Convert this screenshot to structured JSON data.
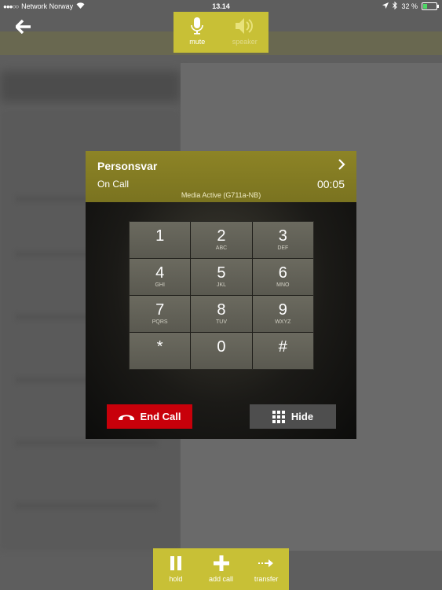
{
  "status_bar": {
    "signal": "●●●○○",
    "carrier": "Network Norway",
    "time": "13.14",
    "battery": "32 %"
  },
  "top_controls": {
    "mute_label": "mute",
    "speaker_label": "speaker"
  },
  "call": {
    "caller_name": "Personsvar",
    "status": "On Call",
    "timer": "00:05",
    "media_status": "Media Active (G711a-NB)"
  },
  "keypad": [
    {
      "digit": "1",
      "letters": ""
    },
    {
      "digit": "2",
      "letters": "ABC"
    },
    {
      "digit": "3",
      "letters": "DEF"
    },
    {
      "digit": "4",
      "letters": "GHI"
    },
    {
      "digit": "5",
      "letters": "JKL"
    },
    {
      "digit": "6",
      "letters": "MNO"
    },
    {
      "digit": "7",
      "letters": "PQRS"
    },
    {
      "digit": "8",
      "letters": "TUV"
    },
    {
      "digit": "9",
      "letters": "WXYZ"
    },
    {
      "digit": "*",
      "letters": ""
    },
    {
      "digit": "0",
      "letters": ""
    },
    {
      "digit": "#",
      "letters": ""
    }
  ],
  "buttons": {
    "end_call": "End Call",
    "hide": "Hide"
  },
  "bottom_controls": {
    "hold_label": "hold",
    "add_call_label": "add call",
    "transfer_label": "transfer"
  },
  "colors": {
    "accent": "#c8c036",
    "end_call": "#c8000a",
    "header": "#857d23"
  },
  "battery_level": 0.32
}
